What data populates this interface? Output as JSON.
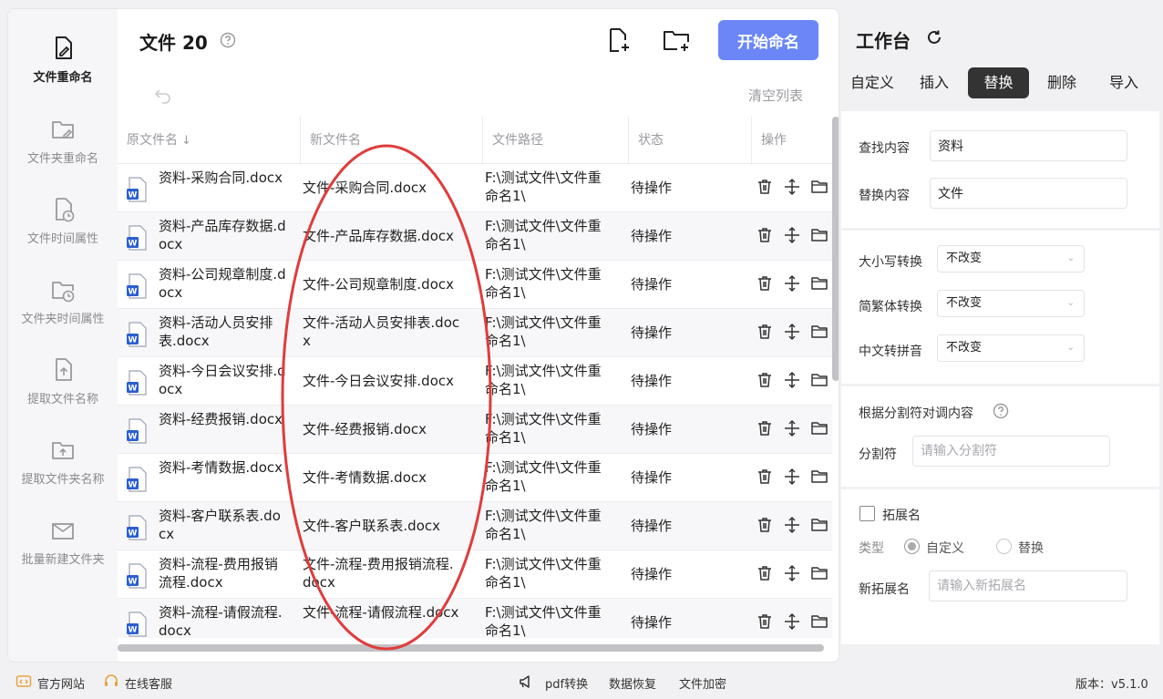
{
  "header": {
    "title": "文件 20",
    "start_button": "开始命名",
    "clear_list": "清空列表"
  },
  "nav": {
    "items": [
      {
        "label": "文件重命名",
        "icon": "file-rename-icon",
        "active": true
      },
      {
        "label": "文件夹重命名",
        "icon": "folder-rename-icon"
      },
      {
        "label": "文件时间属性",
        "icon": "file-time-icon"
      },
      {
        "label": "文件夹时间属性",
        "icon": "folder-time-icon"
      },
      {
        "label": "提取文件名称",
        "icon": "extract-file-name-icon"
      },
      {
        "label": "提取文件夹名称",
        "icon": "extract-folder-name-icon"
      },
      {
        "label": "批量新建文件夹",
        "icon": "batch-new-folder-icon"
      }
    ]
  },
  "table": {
    "columns": [
      "原文件名",
      "新文件名",
      "文件路径",
      "状态",
      "操作"
    ],
    "rows": [
      {
        "original": "资料-采购合同.docx",
        "new": "文件-采购合同.docx",
        "path": "F:\\测试文件\\文件重命名1\\",
        "status": "待操作"
      },
      {
        "original": "资料-产品库存数据.docx",
        "new": "文件-产品库存数据.docx",
        "path": "F:\\测试文件\\文件重命名1\\",
        "status": "待操作"
      },
      {
        "original": "资料-公司规章制度.docx",
        "new": "文件-公司规章制度.docx",
        "path": "F:\\测试文件\\文件重命名1\\",
        "status": "待操作"
      },
      {
        "original": "资料-活动人员安排表.docx",
        "new": "文件-活动人员安排表.docx",
        "path": "F:\\测试文件\\文件重命名1\\",
        "status": "待操作"
      },
      {
        "original": "资料-今日会议安排.docx",
        "new": "文件-今日会议安排.docx",
        "path": "F:\\测试文件\\文件重命名1\\",
        "status": "待操作"
      },
      {
        "original": "资料-经费报销.docx",
        "new": "文件-经费报销.docx",
        "path": "F:\\测试文件\\文件重命名1\\",
        "status": "待操作"
      },
      {
        "original": "资料-考情数据.docx",
        "new": "文件-考情数据.docx",
        "path": "F:\\测试文件\\文件重命名1\\",
        "status": "待操作"
      },
      {
        "original": "资料-客户联系表.docx",
        "new": "文件-客户联系表.docx",
        "path": "F:\\测试文件\\文件重命名1\\",
        "status": "待操作"
      },
      {
        "original": "资料-流程-费用报销流程.docx",
        "new": "文件-流程-费用报销流程.docx",
        "path": "F:\\测试文件\\文件重命名1\\",
        "status": "待操作"
      },
      {
        "original": "资料-流程-请假流程.docx",
        "new": "文件-流程-请假流程.docx",
        "path": "F:\\测试文件\\文件重命名1\\",
        "status": "待操作"
      }
    ]
  },
  "workbench": {
    "title": "工作台",
    "tabs": [
      "自定义",
      "插入",
      "替换",
      "删除",
      "导入"
    ],
    "active_tab": "替换",
    "find_label": "查找内容",
    "find_value": "资料",
    "replace_label": "替换内容",
    "replace_value": "文件",
    "case_label": "大小写转换",
    "case_value": "不改变",
    "trad_label": "简繁体转换",
    "trad_value": "不改变",
    "pinyin_label": "中文转拼音",
    "pinyin_value": "不改变",
    "swap_label": "根据分割符对调内容",
    "separator_label": "分割符",
    "separator_placeholder": "请输入分割符",
    "ext_label": "拓展名",
    "type_label": "类型",
    "type_custom": "自定义",
    "type_replace": "替换",
    "new_ext_label": "新拓展名",
    "new_ext_placeholder": "请输入新拓展名"
  },
  "footer": {
    "website": "官方网站",
    "service": "在线客服",
    "pdf": "pdf转换",
    "recovery": "数据恢复",
    "encrypt": "文件加密",
    "version": "版本：v5.1.0"
  },
  "colors": {
    "accent": "#6b86f7",
    "active_tab": "#333333",
    "highlight_ellipse": "#e03c3c"
  }
}
